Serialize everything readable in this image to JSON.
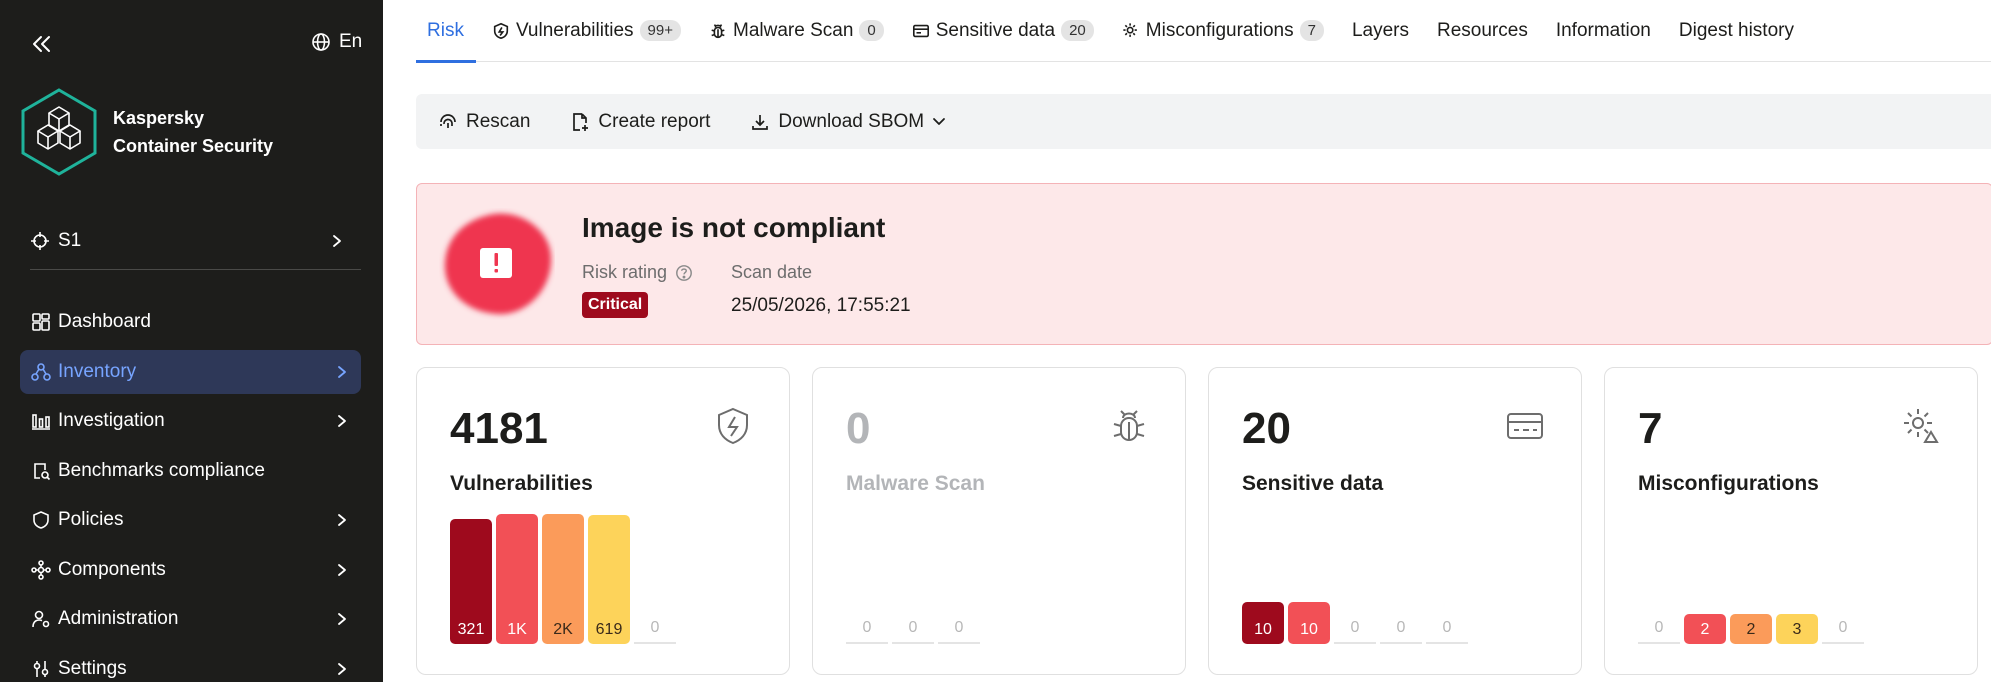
{
  "sidebar": {
    "lang": "En",
    "brand_line1": "Kaspersky",
    "brand_line2": "Container Security",
    "project": "S1",
    "items": [
      {
        "label": "Dashboard"
      },
      {
        "label": "Inventory"
      },
      {
        "label": "Investigation"
      },
      {
        "label": "Benchmarks compliance"
      },
      {
        "label": "Policies"
      },
      {
        "label": "Components"
      },
      {
        "label": "Administration"
      },
      {
        "label": "Settings"
      }
    ]
  },
  "tabs": [
    {
      "label": "Risk"
    },
    {
      "label": "Vulnerabilities",
      "badge": "99+"
    },
    {
      "label": "Malware Scan",
      "badge": "0"
    },
    {
      "label": "Sensitive data",
      "badge": "20"
    },
    {
      "label": "Misconfigurations",
      "badge": "7"
    },
    {
      "label": "Layers"
    },
    {
      "label": "Resources"
    },
    {
      "label": "Information"
    },
    {
      "label": "Digest history"
    }
  ],
  "toolbar": {
    "rescan": "Rescan",
    "create_report": "Create report",
    "download_sbom": "Download SBOM"
  },
  "alert": {
    "title": "Image is not compliant",
    "risk_label": "Risk rating",
    "risk_value": "Critical",
    "scan_label": "Scan date",
    "scan_date": "25/05/2026, 17:55:21"
  },
  "cards": [
    {
      "count": "4181",
      "label": "Vulnerabilities",
      "bars": [
        "321",
        "1K",
        "2K",
        "619",
        "0"
      ]
    },
    {
      "count": "0",
      "label": "Malware Scan",
      "bars": [
        "0",
        "0",
        "0"
      ]
    },
    {
      "count": "20",
      "label": "Sensitive data",
      "bars": [
        "10",
        "10",
        "0",
        "0",
        "0"
      ]
    },
    {
      "count": "7",
      "label": "Misconfigurations",
      "bars": [
        "0",
        "2",
        "2",
        "3",
        "0"
      ]
    }
  ],
  "colors": {
    "sidebar_bg": "#1d1d1b",
    "active_nav_bg": "#2e3858",
    "active_nav_text": "#77a4ff",
    "accent": "#2f6fe0",
    "critical": "#9e0a1d",
    "high": "#f25056",
    "medium": "#fb9b5a",
    "low": "#fdd35a"
  }
}
